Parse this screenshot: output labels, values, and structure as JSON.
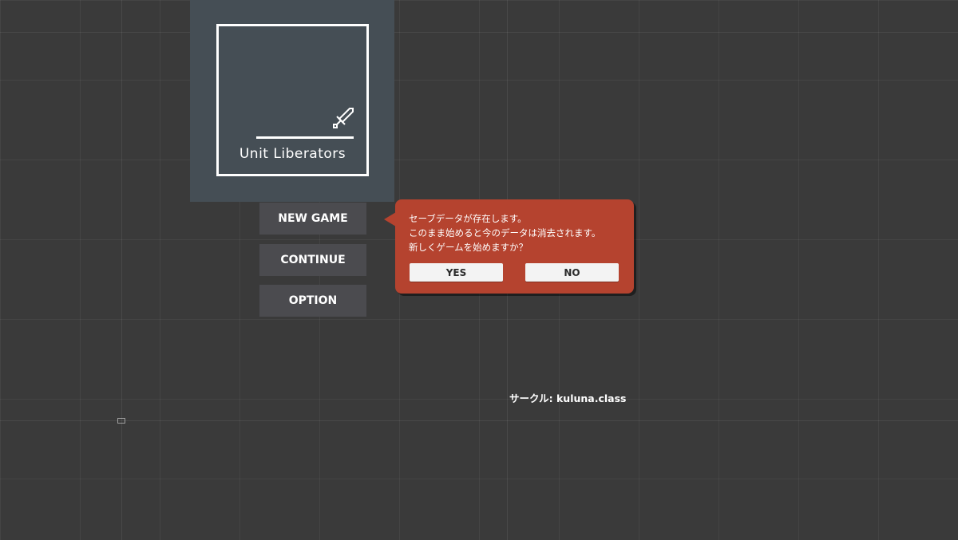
{
  "logo": {
    "title": "Unit Liberators",
    "icon": "sword-icon"
  },
  "menu": {
    "new_game": "NEW GAME",
    "continue": "CONTINUE",
    "option": "OPTION"
  },
  "dialog": {
    "line1": "セーブデータが存在します。",
    "line2": "このまま始めると今のデータは消去されます。",
    "line3": "新しくゲームを始めますか？",
    "yes_label": "YES",
    "no_label": "NO"
  },
  "credit": "サークル: kuluna.class",
  "colors": {
    "background": "#3a3a3a",
    "title_panel": "#454e55",
    "menu_button": "#4b4b4f",
    "dialog": "#b5432f",
    "dialog_button": "#f3f3f3"
  }
}
